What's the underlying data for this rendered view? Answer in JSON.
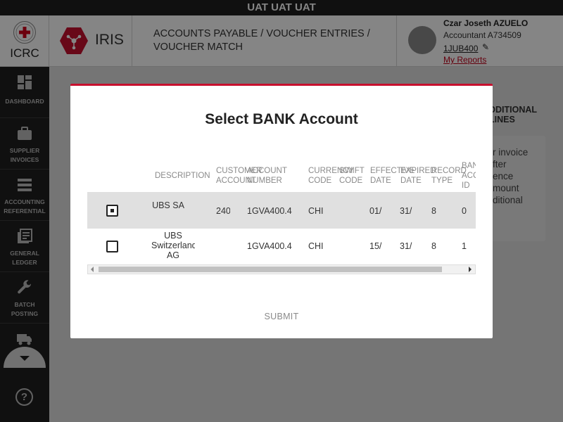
{
  "env_banner": "UAT UAT UAT",
  "header": {
    "org_name": "ICRC",
    "app_name": "IRIS",
    "breadcrumb": "ACCOUNTS PAYABLE / VOUCHER ENTRIES / VOUCHER MATCH",
    "user": {
      "name": "Czar Joseth AZUELO",
      "role": "Accountant A734509",
      "code": "1JUB400",
      "reports_link": "My Reports"
    }
  },
  "sidebar": {
    "items": [
      {
        "label": "DASHBOARD",
        "icon": "dashboard-icon"
      },
      {
        "label": "SUPPLIER INVOICES",
        "icon": "briefcase-icon"
      },
      {
        "label": "ACCOUNTING REFERENTIAL",
        "icon": "list-icon"
      },
      {
        "label": "GENERAL LEDGER",
        "icon": "ledger-icon"
      },
      {
        "label": "BATCH POSTING",
        "icon": "wrench-icon"
      },
      {
        "label": "",
        "icon": "truck-icon"
      }
    ],
    "help_glyph": "?"
  },
  "background": {
    "section_label": "DDITIONAL LINES",
    "card_text": "r invoice\nfter\nence\nmount\nditional"
  },
  "modal": {
    "title": "Select BANK Account",
    "columns": [
      "DESCRIPTION",
      "CUSTOMER ACCOUNT",
      "ACCOUNT NUMBER",
      "CURRENCY CODE",
      "SWIFT CODE",
      "EFFECTIVE DATE",
      "EXPIRED DATE",
      "RECORD TYPE",
      "BANK ACC ID"
    ],
    "rows": [
      {
        "selected": true,
        "description": "UBS SA",
        "customer_account": "240",
        "account_number": "1GVA400.4",
        "currency": "CHI",
        "swift": "",
        "effective": "01/",
        "expired": "31/",
        "record_type": "8",
        "bank_acc_id": "0"
      },
      {
        "selected": false,
        "description": "UBS Switzerland AG",
        "customer_account": "",
        "account_number": "1GVA400.4",
        "currency": "CHI",
        "swift": "",
        "effective": "15/",
        "expired": "31/",
        "record_type": "8",
        "bank_acc_id": "1"
      }
    ],
    "submit_label": "SUBMIT"
  },
  "colors": {
    "accent": "#c8102e",
    "sidebar_bg": "#1f1f1f",
    "selected_row": "#e0e0e0"
  }
}
